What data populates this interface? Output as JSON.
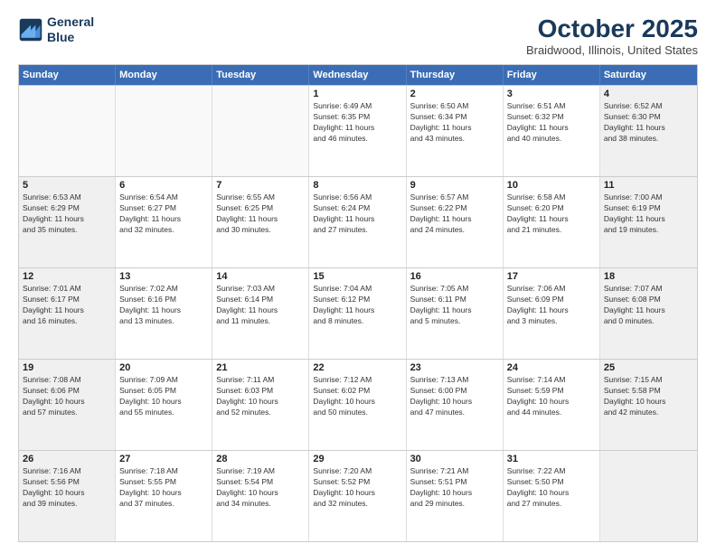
{
  "logo": {
    "line1": "General",
    "line2": "Blue"
  },
  "title": "October 2025",
  "subtitle": "Braidwood, Illinois, United States",
  "weekdays": [
    "Sunday",
    "Monday",
    "Tuesday",
    "Wednesday",
    "Thursday",
    "Friday",
    "Saturday"
  ],
  "rows": [
    [
      {
        "day": "",
        "info": "",
        "empty": true
      },
      {
        "day": "",
        "info": "",
        "empty": true
      },
      {
        "day": "",
        "info": "",
        "empty": true
      },
      {
        "day": "1",
        "info": "Sunrise: 6:49 AM\nSunset: 6:35 PM\nDaylight: 11 hours\nand 46 minutes."
      },
      {
        "day": "2",
        "info": "Sunrise: 6:50 AM\nSunset: 6:34 PM\nDaylight: 11 hours\nand 43 minutes."
      },
      {
        "day": "3",
        "info": "Sunrise: 6:51 AM\nSunset: 6:32 PM\nDaylight: 11 hours\nand 40 minutes."
      },
      {
        "day": "4",
        "info": "Sunrise: 6:52 AM\nSunset: 6:30 PM\nDaylight: 11 hours\nand 38 minutes.",
        "shaded": true
      }
    ],
    [
      {
        "day": "5",
        "info": "Sunrise: 6:53 AM\nSunset: 6:29 PM\nDaylight: 11 hours\nand 35 minutes.",
        "shaded": true
      },
      {
        "day": "6",
        "info": "Sunrise: 6:54 AM\nSunset: 6:27 PM\nDaylight: 11 hours\nand 32 minutes."
      },
      {
        "day": "7",
        "info": "Sunrise: 6:55 AM\nSunset: 6:25 PM\nDaylight: 11 hours\nand 30 minutes."
      },
      {
        "day": "8",
        "info": "Sunrise: 6:56 AM\nSunset: 6:24 PM\nDaylight: 11 hours\nand 27 minutes."
      },
      {
        "day": "9",
        "info": "Sunrise: 6:57 AM\nSunset: 6:22 PM\nDaylight: 11 hours\nand 24 minutes."
      },
      {
        "day": "10",
        "info": "Sunrise: 6:58 AM\nSunset: 6:20 PM\nDaylight: 11 hours\nand 21 minutes."
      },
      {
        "day": "11",
        "info": "Sunrise: 7:00 AM\nSunset: 6:19 PM\nDaylight: 11 hours\nand 19 minutes.",
        "shaded": true
      }
    ],
    [
      {
        "day": "12",
        "info": "Sunrise: 7:01 AM\nSunset: 6:17 PM\nDaylight: 11 hours\nand 16 minutes.",
        "shaded": true
      },
      {
        "day": "13",
        "info": "Sunrise: 7:02 AM\nSunset: 6:16 PM\nDaylight: 11 hours\nand 13 minutes."
      },
      {
        "day": "14",
        "info": "Sunrise: 7:03 AM\nSunset: 6:14 PM\nDaylight: 11 hours\nand 11 minutes."
      },
      {
        "day": "15",
        "info": "Sunrise: 7:04 AM\nSunset: 6:12 PM\nDaylight: 11 hours\nand 8 minutes."
      },
      {
        "day": "16",
        "info": "Sunrise: 7:05 AM\nSunset: 6:11 PM\nDaylight: 11 hours\nand 5 minutes."
      },
      {
        "day": "17",
        "info": "Sunrise: 7:06 AM\nSunset: 6:09 PM\nDaylight: 11 hours\nand 3 minutes."
      },
      {
        "day": "18",
        "info": "Sunrise: 7:07 AM\nSunset: 6:08 PM\nDaylight: 11 hours\nand 0 minutes.",
        "shaded": true
      }
    ],
    [
      {
        "day": "19",
        "info": "Sunrise: 7:08 AM\nSunset: 6:06 PM\nDaylight: 10 hours\nand 57 minutes.",
        "shaded": true
      },
      {
        "day": "20",
        "info": "Sunrise: 7:09 AM\nSunset: 6:05 PM\nDaylight: 10 hours\nand 55 minutes."
      },
      {
        "day": "21",
        "info": "Sunrise: 7:11 AM\nSunset: 6:03 PM\nDaylight: 10 hours\nand 52 minutes."
      },
      {
        "day": "22",
        "info": "Sunrise: 7:12 AM\nSunset: 6:02 PM\nDaylight: 10 hours\nand 50 minutes."
      },
      {
        "day": "23",
        "info": "Sunrise: 7:13 AM\nSunset: 6:00 PM\nDaylight: 10 hours\nand 47 minutes."
      },
      {
        "day": "24",
        "info": "Sunrise: 7:14 AM\nSunset: 5:59 PM\nDaylight: 10 hours\nand 44 minutes."
      },
      {
        "day": "25",
        "info": "Sunrise: 7:15 AM\nSunset: 5:58 PM\nDaylight: 10 hours\nand 42 minutes.",
        "shaded": true
      }
    ],
    [
      {
        "day": "26",
        "info": "Sunrise: 7:16 AM\nSunset: 5:56 PM\nDaylight: 10 hours\nand 39 minutes.",
        "shaded": true
      },
      {
        "day": "27",
        "info": "Sunrise: 7:18 AM\nSunset: 5:55 PM\nDaylight: 10 hours\nand 37 minutes."
      },
      {
        "day": "28",
        "info": "Sunrise: 7:19 AM\nSunset: 5:54 PM\nDaylight: 10 hours\nand 34 minutes."
      },
      {
        "day": "29",
        "info": "Sunrise: 7:20 AM\nSunset: 5:52 PM\nDaylight: 10 hours\nand 32 minutes."
      },
      {
        "day": "30",
        "info": "Sunrise: 7:21 AM\nSunset: 5:51 PM\nDaylight: 10 hours\nand 29 minutes."
      },
      {
        "day": "31",
        "info": "Sunrise: 7:22 AM\nSunset: 5:50 PM\nDaylight: 10 hours\nand 27 minutes."
      },
      {
        "day": "",
        "info": "",
        "empty": true,
        "shaded": true
      }
    ]
  ]
}
